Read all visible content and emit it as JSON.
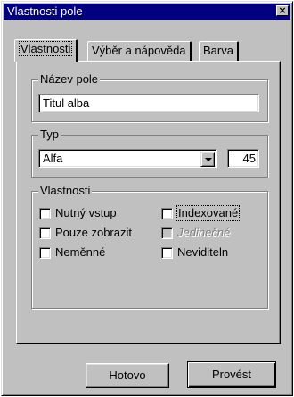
{
  "window": {
    "title": "Vlastnosti pole",
    "close_label": "×"
  },
  "tabs": [
    {
      "label": "Vlastnosti",
      "active": true
    },
    {
      "label": "Výběr a nápověda",
      "active": false
    },
    {
      "label": "Barva",
      "active": false
    }
  ],
  "field_name": {
    "label": "Název pole",
    "value": "Titul alba"
  },
  "type": {
    "label": "Typ",
    "selected": "Alfa",
    "length": "45"
  },
  "properties": {
    "label": "Vlastnosti",
    "items": [
      {
        "label": "Nutný vstup",
        "checked": false,
        "enabled": true
      },
      {
        "label": "Indexované",
        "checked": false,
        "enabled": true,
        "focused": true
      },
      {
        "label": "Pouze zobrazit",
        "checked": false,
        "enabled": true
      },
      {
        "label": "Jedinečné",
        "checked": false,
        "enabled": false
      },
      {
        "label": "Neměnné",
        "checked": false,
        "enabled": true
      },
      {
        "label": "Neviditeln",
        "checked": false,
        "enabled": true
      }
    ]
  },
  "buttons": {
    "ok": "Hotovo",
    "apply": "Provést"
  }
}
